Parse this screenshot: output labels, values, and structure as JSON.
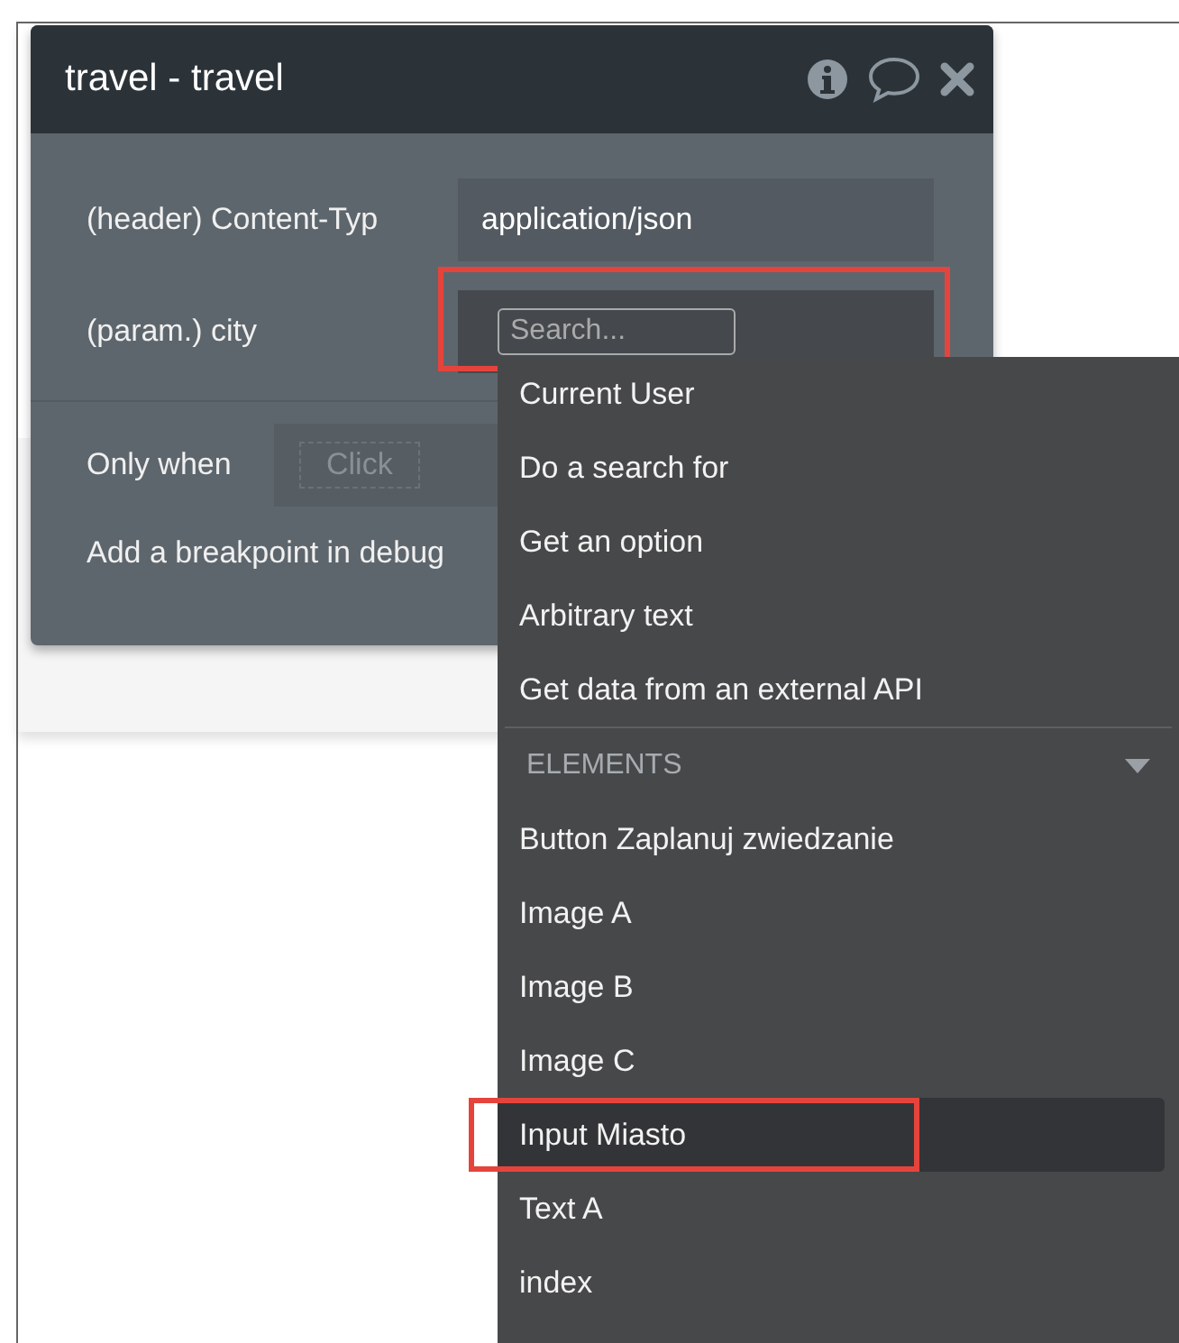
{
  "panel": {
    "title": "travel - travel",
    "fields": [
      {
        "kind": "text",
        "label": "(header) Content-Typ",
        "value": "application/json",
        "highlighted": false
      },
      {
        "kind": "search",
        "label": "(param.) city",
        "placeholder": "Search...",
        "highlighted": true
      }
    ],
    "only_when": {
      "label": "Only when",
      "button": "Click"
    },
    "breakpoint_label": "Add a breakpoint in debug"
  },
  "dropdown": {
    "items": [
      {
        "kind": "item",
        "label": "Current User",
        "selected": false,
        "highlighted": false
      },
      {
        "kind": "item",
        "label": "Do a search for",
        "selected": false,
        "highlighted": false
      },
      {
        "kind": "item",
        "label": "Get an option",
        "selected": false,
        "highlighted": false
      },
      {
        "kind": "item",
        "label": "Arbitrary text",
        "selected": false,
        "highlighted": false
      },
      {
        "kind": "item",
        "label": "Get data from an external API",
        "selected": false,
        "highlighted": false
      },
      {
        "kind": "section",
        "label": "ELEMENTS",
        "expanded": true
      },
      {
        "kind": "item",
        "label": "Button Zaplanuj zwiedzanie",
        "selected": false,
        "highlighted": false
      },
      {
        "kind": "item",
        "label": "Image A",
        "selected": false,
        "highlighted": false
      },
      {
        "kind": "item",
        "label": "Image B",
        "selected": false,
        "highlighted": false
      },
      {
        "kind": "item",
        "label": "Image C",
        "selected": false,
        "highlighted": false
      },
      {
        "kind": "item",
        "label": "Input Miasto",
        "selected": true,
        "highlighted": true
      },
      {
        "kind": "item",
        "label": "Text A",
        "selected": false,
        "highlighted": false
      },
      {
        "kind": "item",
        "label": "index",
        "selected": false,
        "highlighted": false
      }
    ]
  }
}
